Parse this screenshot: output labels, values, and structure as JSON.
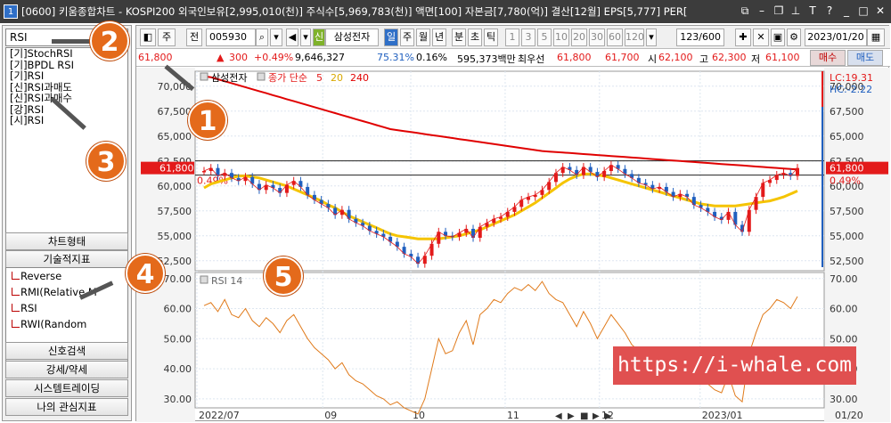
{
  "title": {
    "num": "1",
    "text": "[0600] 키움종합차트 - KOSPI200 외국인보유[2,995,010(천)] 주식수[5,969,783(천)] 액면[100] 자본금[7,780(억)] 결산[12월] EPS[5,777] PER["
  },
  "title_icons": [
    "window-icon",
    "minus-icon",
    "restore-icon",
    "pin-icon",
    "text-icon",
    "help-icon",
    "minimize-icon",
    "maximize-icon",
    "close-icon"
  ],
  "search": {
    "value": "RSI"
  },
  "indicators": [
    "[기]StochRSI",
    "[기]BPDL RSI",
    "[기]RSI",
    "[신]RSI과매도",
    "[신]RSI과매수",
    "[강]RSI",
    "[시]RSI"
  ],
  "left_buttons": {
    "chart_type": "차트형태",
    "tech": "기술적지표",
    "signal": "신호검색",
    "strength": "강세/약세",
    "trading": "시스템트레이딩",
    "fav": "나의 관심지표"
  },
  "tree": [
    "Reverse",
    "RMI(Relative M",
    "RSI",
    "RWI(Random"
  ],
  "toolbar": {
    "period": "주",
    "prev": "전",
    "code": "005930",
    "badge": "신",
    "name": "삼성전자",
    "tabs": [
      "일",
      "주",
      "월",
      "년",
      "분",
      "초",
      "틱"
    ],
    "nums": [
      "1",
      "3",
      "5",
      "10",
      "20",
      "30",
      "60",
      "120"
    ],
    "count": "123/600",
    "date": "2023/01/20"
  },
  "quote": {
    "price": "61,800",
    "change": "300",
    "pct": "+0.49%",
    "volume": "9,646,327",
    "r1": "75.31%",
    "r2": "0.16%",
    "amount": "595,373백만",
    "best": "최우선",
    "bid": "61,800",
    "ask": "61,700",
    "si_label": "시",
    "si": "62,100",
    "go_label": "고",
    "go": "62,300",
    "jeo_label": "저",
    "jeo": "61,100",
    "buy": "매수",
    "sell": "매도"
  },
  "price_panel": {
    "legend_name": "삼성전자",
    "legend_ma": "종가 단순",
    "ma1": "5",
    "ma2": "20",
    "ma3": "240",
    "lc": "LC:19.31",
    "hc": "HC:-2.22",
    "current": "61,800",
    "pct": "0.49%",
    "y_ticks": [
      "70,000",
      "67,500",
      "65,000",
      "62,500",
      "60,000",
      "57,500",
      "55,000",
      "52,500"
    ]
  },
  "rsi_panel": {
    "label": "RSI 14",
    "y_ticks": [
      "70.00",
      "60.00",
      "50.00",
      "40.00",
      "30.00"
    ]
  },
  "x_labels": [
    "2022/07",
    "09",
    "10",
    "11",
    "12",
    "2023/01",
    "01/20"
  ],
  "watermark": "https://i-whale.com",
  "badges": [
    "1",
    "2",
    "3",
    "4",
    "5"
  ],
  "colors": {
    "up": "#e31a1a",
    "down": "#1f5fbf",
    "ma240": "#e00000",
    "ma20": "#f5c400",
    "rsi": "#e07a1a"
  },
  "chart_data": {
    "type": "candlestick",
    "price_series": [
      61500,
      61800,
      61000,
      61300,
      60800,
      60500,
      60900,
      60200,
      59600,
      60100,
      59800,
      59300,
      60100,
      60500,
      59900,
      59100,
      58600,
      58200,
      57800,
      57100,
      57600,
      56700,
      56300,
      56000,
      55500,
      55200,
      54900,
      54400,
      53900,
      53200,
      52900,
      52200,
      53000,
      54200,
      55400,
      55000,
      54900,
      55300,
      55700,
      54800,
      55900,
      56300,
      56700,
      56900,
      57400,
      57900,
      58600,
      58900,
      59100,
      59600,
      60400,
      61300,
      61900,
      61600,
      61100,
      61900,
      61400,
      60900,
      61500,
      62100,
      61700,
      61200,
      60800,
      60300,
      60100,
      59700,
      59900,
      59400,
      58900,
      59200,
      58900,
      58100,
      57800,
      57400,
      56900,
      56600,
      57400,
      56100,
      55400,
      57600,
      58900,
      60300,
      60600,
      61100,
      61300,
      61000,
      61800
    ],
    "ma240": [
      71000,
      70900,
      70700,
      70500,
      70300,
      70100,
      69900,
      69700,
      69500,
      69300,
      69100,
      68900,
      68700,
      68500,
      68300,
      68100,
      67900,
      67700,
      67500,
      67300,
      67100,
      66900,
      66700,
      66500,
      66300,
      66100,
      65900,
      65700,
      65600,
      65500,
      65400,
      65300,
      65200,
      65100,
      65000,
      64900,
      64800,
      64700,
      64600,
      64500,
      64400,
      64300,
      64200,
      64100,
      64000,
      63900,
      63800,
      63700,
      63600,
      63500,
      63450,
      63400,
      63350,
      63300,
      63250,
      63200,
      63150,
      63100,
      63050,
      63000,
      62950,
      62900,
      62850,
      62800,
      62750,
      62700,
      62650,
      62600,
      62550,
      62500,
      62450,
      62400,
      62350,
      62300,
      62250,
      62200,
      62150,
      62100,
      62050,
      62000,
      61950,
      61900,
      61850,
      61800,
      61750,
      61700,
      61650
    ],
    "ma20": [
      59800,
      60200,
      60400,
      60600,
      60800,
      61000,
      61000,
      60900,
      60800,
      60600,
      60400,
      60200,
      60000,
      59700,
      59400,
      59100,
      58800,
      58500,
      58100,
      57800,
      57400,
      57000,
      56700,
      56400,
      56100,
      55800,
      55500,
      55200,
      55000,
      54900,
      54800,
      54700,
      54700,
      54700,
      54700,
      54800,
      54900,
      55000,
      55200,
      55400,
      55600,
      55900,
      56200,
      56500,
      56800,
      57100,
      57500,
      57900,
      58300,
      58800,
      59300,
      59800,
      60300,
      60700,
      61000,
      61200,
      61200,
      61100,
      61000,
      60800,
      60600,
      60400,
      60200,
      60000,
      59800,
      59600,
      59400,
      59200,
      59000,
      58800,
      58600,
      58400,
      58200,
      58100,
      58000,
      58000,
      58000,
      58000,
      58100,
      58200,
      58300,
      58400,
      58500,
      58700,
      58900,
      59200,
      59500
    ],
    "rsi": [
      61,
      62,
      59,
      63,
      58,
      57,
      60,
      56,
      54,
      57,
      55,
      52,
      56,
      58,
      54,
      50,
      47,
      45,
      43,
      40,
      42,
      38,
      36,
      35,
      33,
      31,
      30,
      28,
      29,
      27,
      26,
      25,
      30,
      40,
      50,
      45,
      46,
      52,
      56,
      48,
      58,
      60,
      63,
      62,
      65,
      67,
      66,
      68,
      66,
      69,
      65,
      63,
      62,
      58,
      54,
      59,
      55,
      50,
      54,
      58,
      55,
      52,
      48,
      46,
      45,
      43,
      44,
      42,
      40,
      43,
      42,
      38,
      37,
      35,
      33,
      32,
      38,
      31,
      29,
      45,
      52,
      58,
      60,
      63,
      62,
      60,
      64
    ],
    "rsi_ylim": [
      27,
      72
    ],
    "price_ylim": [
      51500,
      71500
    ]
  }
}
